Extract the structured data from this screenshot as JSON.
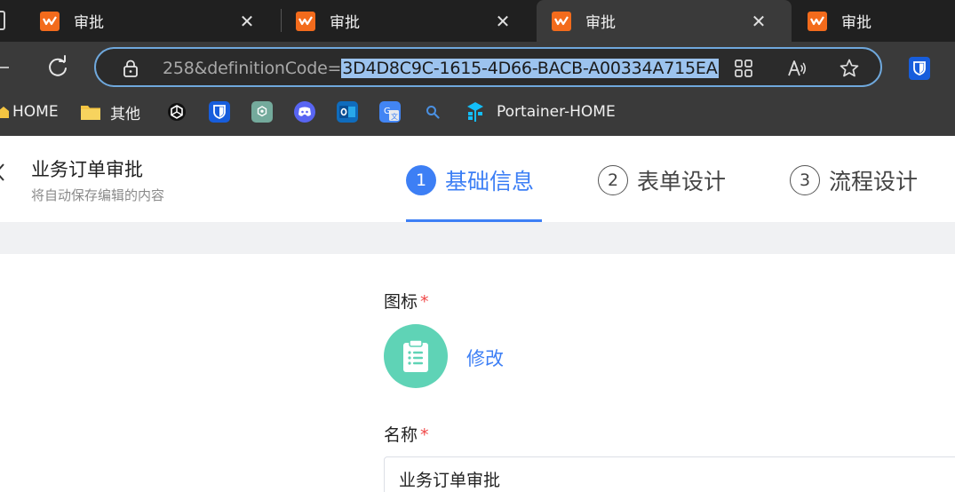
{
  "browser": {
    "tabs": [
      {
        "title": "审批",
        "active": false
      },
      {
        "title": "审批",
        "active": false
      },
      {
        "title": "审批",
        "active": true
      },
      {
        "title": "审批",
        "active": false
      }
    ],
    "tab_close_glyph": "✕",
    "address": {
      "prefix": "258&definitionCode=",
      "selected": "3D4D8C9C-1615-4D66-BACB-A00334A715EA"
    },
    "bookmarks": [
      {
        "label": "HOME",
        "icon": "home-icon"
      },
      {
        "label": "其他",
        "icon": "folder-icon"
      },
      {
        "label": "",
        "icon": "openai-icon"
      },
      {
        "label": "",
        "icon": "bitwarden-icon"
      },
      {
        "label": "",
        "icon": "chatgpt-icon"
      },
      {
        "label": "",
        "icon": "discord-icon"
      },
      {
        "label": "",
        "icon": "outlook-icon"
      },
      {
        "label": "",
        "icon": "translate-icon"
      },
      {
        "label": "",
        "icon": "search-icon"
      },
      {
        "label": "Portainer-HOME",
        "icon": "portainer-icon"
      }
    ]
  },
  "app": {
    "title": "业务订单审批",
    "subtitle": "将自动保存编辑的内容",
    "steps": [
      {
        "num": "1",
        "label": "基础信息",
        "active": true
      },
      {
        "num": "2",
        "label": "表单设计",
        "active": false
      },
      {
        "num": "3",
        "label": "流程设计",
        "active": false
      }
    ],
    "form": {
      "icon_label": "图标",
      "modify_label": "修改",
      "name_label": "名称",
      "name_value": "业务订单审批",
      "required_mark": "*"
    }
  },
  "colors": {
    "accent": "#3d7ff5",
    "favicon": "#f36b1c",
    "icon_bg": "#5fd3b6",
    "required": "#f04848"
  }
}
